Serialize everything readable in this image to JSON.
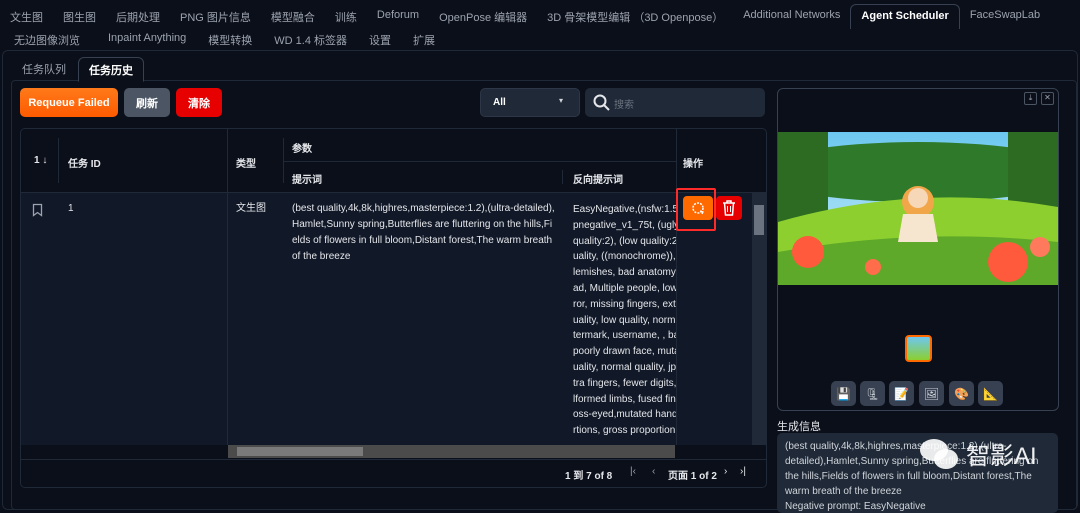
{
  "nav": {
    "row1": [
      "文生图",
      "图生图",
      "后期处理",
      "PNG 图片信息",
      "模型融合",
      "训练",
      "Deforum",
      "OpenPose 编辑器",
      "3D 骨架模型编辑 （3D Openpose）",
      "Additional Networks",
      "Agent Scheduler",
      "FaceSwapLab"
    ],
    "row2": [
      "无边图像浏览",
      "Inpaint Anything",
      "模型转换",
      "WD 1.4 标签器",
      "设置",
      "扩展"
    ],
    "active": "Agent Scheduler"
  },
  "subtabs": [
    "任务队列",
    "任务历史"
  ],
  "toolbar": {
    "requeue": "Requeue Failed",
    "refresh": "刷新",
    "clear": "清除",
    "filter": "All",
    "search_placeholder": "搜索"
  },
  "table": {
    "sort": "1 ↓",
    "headers": {
      "id": "任务 ID",
      "type": "类型",
      "params": "参数",
      "prompt": "提示词",
      "negative": "反向提示词",
      "actions": "操作"
    },
    "rows": [
      {
        "id": "1",
        "type": "文生图",
        "prompt": "(best quality,4k,8k,highres,masterpiece:1.2),(ultra-detailed),Hamlet,Sunny spring,Butterflies are fluttering on the hills,Fields of flowers in full bloom,Distant forest,The warm breath of the breeze",
        "negative_lines": [
          "EasyNegative,(nsfw:1.5),",
          "pnegative_v1_75t, (ugly",
          "quality:2), (low quality:2",
          "uality, ((monochrome)),",
          "lemishes, bad anatomy,",
          "ad, Multiple people, low",
          "ror, missing fingers, extr",
          "uality, low quality, norm",
          "termark, username, , ba",
          "poorly drawn face, muta",
          "uality, normal quality, jp",
          "tra fingers, fewer digits,",
          "lformed limbs, fused fin",
          "oss-eyed,mutated hand",
          "rtions, gross proportion"
        ]
      }
    ]
  },
  "pagination": {
    "range": "1 到 7 of 8",
    "page": "页面 1 of 2"
  },
  "gallery": {
    "info_label": "生成信息",
    "info_text": "(best quality,4k,8k,highres,masterpiece:1.2),(ultra-detailed),Hamlet,Sunny spring,Butterflies are fluttering on the hills,Fields of flowers in full bloom,Distant forest,The warm breath of the breeze",
    "info_neg": "Negative prompt: EasyNegative",
    "tools": [
      "save-icon",
      "zip-icon",
      "text-icon",
      "image-icon",
      "palette-icon",
      "ruler-icon"
    ]
  },
  "watermark": "智影AI",
  "colors": {
    "orange": "#ff6a00",
    "red": "#e60000",
    "highlight": "#ff2b2b"
  }
}
